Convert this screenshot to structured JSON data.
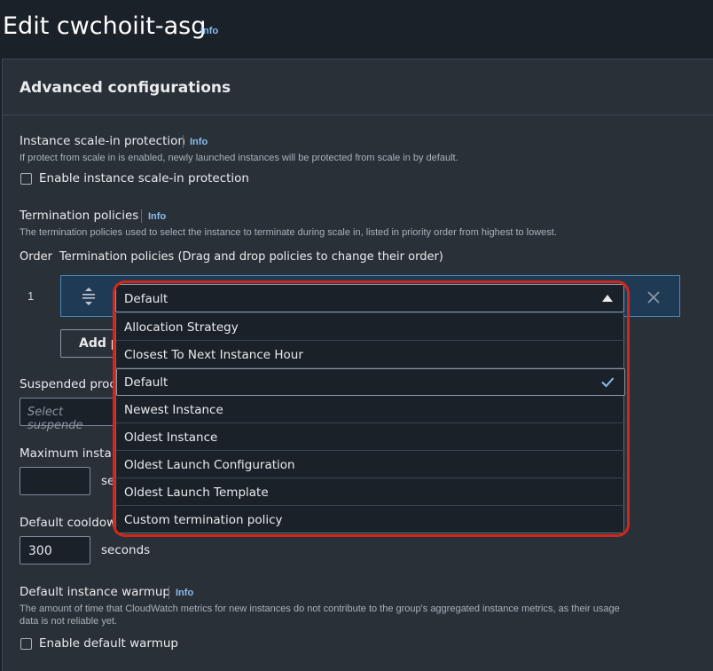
{
  "page": {
    "title": "Edit cwchoiit-asg",
    "info": "Info"
  },
  "panel": {
    "title": "Advanced configurations"
  },
  "scale_in": {
    "label": "Instance scale-in protection",
    "info": "Info",
    "description": "If protect from scale in is enabled, newly launched instances will be protected from scale in by default.",
    "checkbox_label": "Enable instance scale-in protection"
  },
  "termination": {
    "label": "Termination policies",
    "info": "Info",
    "description": "The termination policies used to select the instance to terminate during scale in, listed in priority order from highest to lowest.",
    "col_order": "Order",
    "col_policies": "Termination policies (Drag and drop policies to change their order)",
    "row_order": "1",
    "selected_value": "Default",
    "add_button": "Add p",
    "options": [
      {
        "label": "Allocation Strategy",
        "selected": false
      },
      {
        "label": "Closest To Next Instance Hour",
        "selected": false
      },
      {
        "label": "Default",
        "selected": true
      },
      {
        "label": "Newest Instance",
        "selected": false
      },
      {
        "label": "Oldest Instance",
        "selected": false
      },
      {
        "label": "Oldest Launch Configuration",
        "selected": false
      },
      {
        "label": "Oldest Launch Template",
        "selected": false
      },
      {
        "label": "Custom termination policy",
        "selected": false
      }
    ]
  },
  "suspended": {
    "label": "Suspended proce",
    "placeholder": "Select suspende"
  },
  "max_lifetime": {
    "label": "Maximum instan",
    "value": "",
    "unit": "se"
  },
  "cooldown": {
    "label": "Default cooldow",
    "value": "300",
    "unit": "seconds"
  },
  "warmup": {
    "label": "Default instance warmup",
    "info": "Info",
    "description_line1": "The amount of time that CloudWatch metrics for new instances do not contribute to the group's aggregated instance metrics, as their usage",
    "description_line2": "data is not reliable yet.",
    "checkbox_label": "Enable default warmup"
  },
  "colors": {
    "accent": "#89bdee",
    "highlight": "#d1261a",
    "check": "#89bdee"
  }
}
